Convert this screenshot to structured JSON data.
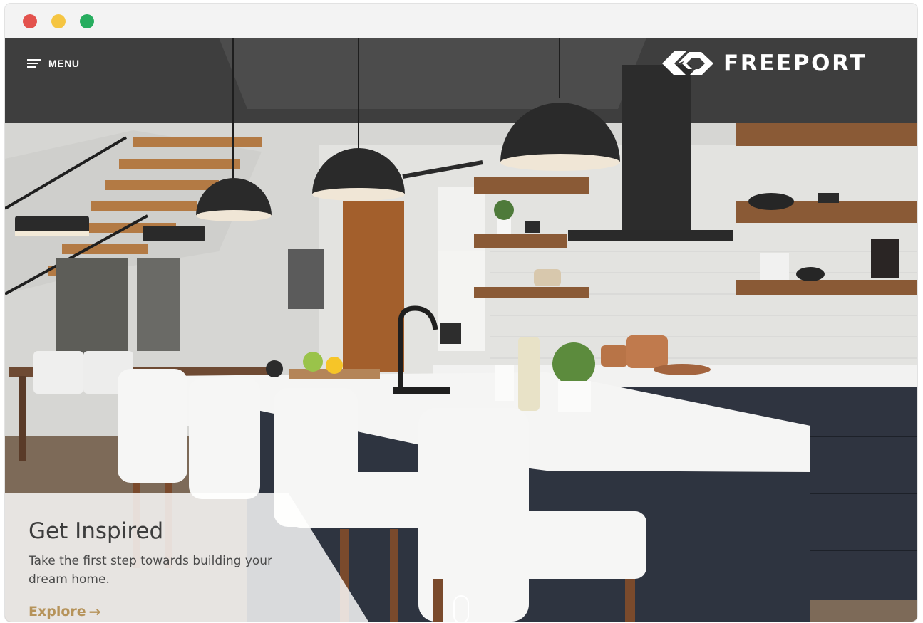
{
  "window": {
    "controls": [
      "close",
      "minimize",
      "maximize"
    ]
  },
  "header": {
    "menu_label": "MENU",
    "menu_icon": "hamburger-icon",
    "brand_name": "FREEPORT",
    "brand_icon": "freeport-logo-icon"
  },
  "hero": {
    "image_subject": "kitchen-interior",
    "title": "Get Inspired",
    "text": "Take the first step towards building your dream home.",
    "link_label": "Explore",
    "link_icon": "arrow-right-icon",
    "scroll_icon": "scroll-indicator-icon"
  },
  "colors": {
    "accent": "#b6935a",
    "traffic_red": "#e3524d",
    "traffic_yellow": "#f5c542",
    "traffic_green": "#27ad5f"
  }
}
